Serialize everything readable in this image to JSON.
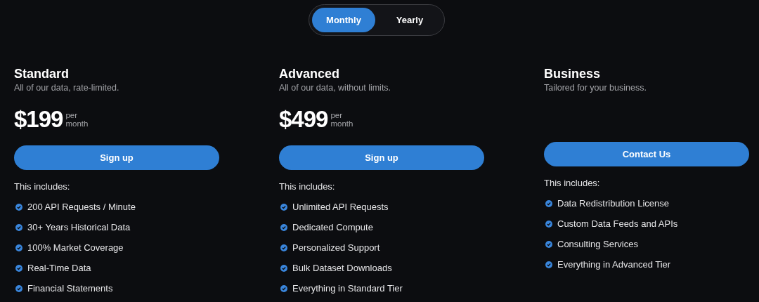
{
  "billing_toggle": [
    {
      "label": "Monthly",
      "selected": true
    },
    {
      "label": "Yearly",
      "selected": false
    }
  ],
  "plans": [
    {
      "name": "Standard",
      "tagline": "All of our data, rate-limited.",
      "price": "$199",
      "price_unit_top": "per",
      "price_unit_bottom": "month",
      "button": "Sign up",
      "includes_label": "This includes:",
      "features": [
        "200 API Requests / Minute",
        "30+ Years Historical Data",
        "100% Market Coverage",
        "Real-Time Data",
        "Financial Statements"
      ]
    },
    {
      "name": "Advanced",
      "tagline": "All of our data, without limits.",
      "price": "$499",
      "price_unit_top": "per",
      "price_unit_bottom": "month",
      "button": "Sign up",
      "includes_label": "This includes:",
      "features": [
        "Unlimited API Requests",
        "Dedicated Compute",
        "Personalized Support",
        "Bulk Dataset Downloads",
        "Everything in Standard Tier"
      ]
    },
    {
      "name": "Business",
      "tagline": "Tailored for your business.",
      "button": "Contact Us",
      "includes_label": "This includes:",
      "features": [
        "Data Redistribution License",
        "Custom Data Feeds and APIs",
        "Consulting Services",
        "Everything in Advanced Tier"
      ]
    }
  ]
}
